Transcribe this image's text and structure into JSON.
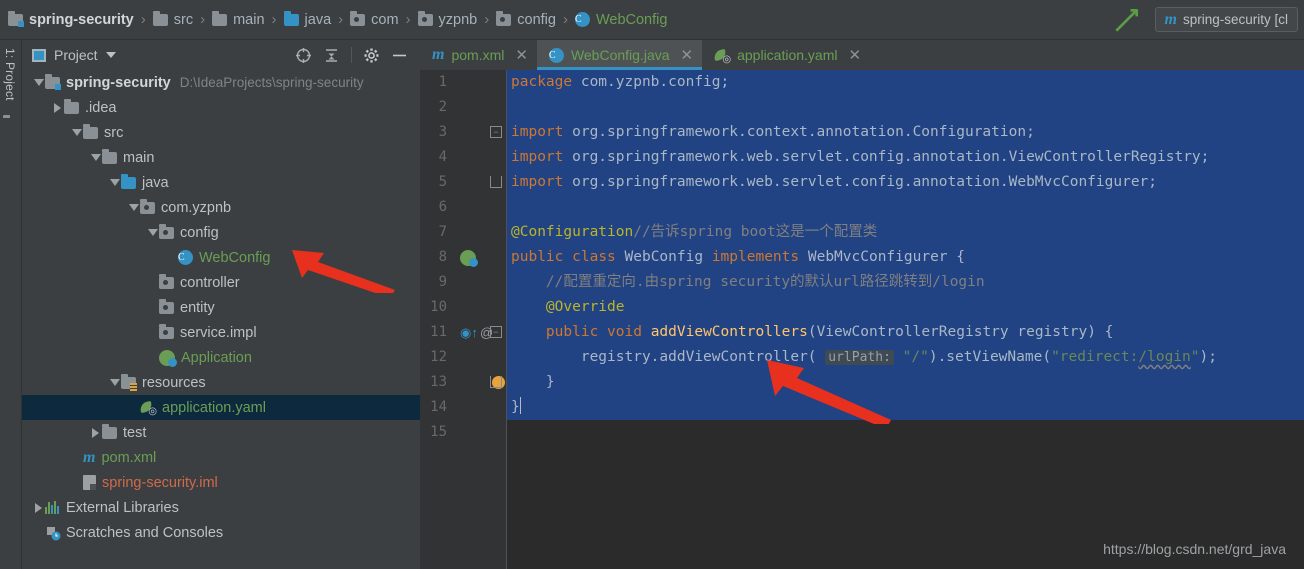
{
  "window": {
    "breadcrumb": [
      {
        "label": "spring-security",
        "icon": "module-folder-icon",
        "kind": "root"
      },
      {
        "label": "src",
        "icon": "folder-icon",
        "kind": "folder"
      },
      {
        "label": "main",
        "icon": "folder-icon",
        "kind": "folder"
      },
      {
        "label": "java",
        "icon": "source-folder-icon",
        "kind": "source"
      },
      {
        "label": "com",
        "icon": "package-icon",
        "kind": "package"
      },
      {
        "label": "yzpnb",
        "icon": "package-icon",
        "kind": "package"
      },
      {
        "label": "config",
        "icon": "package-icon",
        "kind": "package"
      },
      {
        "label": "WebConfig",
        "icon": "java-class-icon",
        "kind": "class"
      }
    ],
    "separator": "›",
    "run_arrow_icon": "run-arrow-icon",
    "run_config": {
      "icon": "maven-icon",
      "label": "spring-security [cl"
    }
  },
  "left_strip": {
    "tool_window_label": "1: Project",
    "folder_icon": "folder-icon"
  },
  "project_panel": {
    "title": "Project",
    "window_icon": "project-window-icon",
    "dropdown_icon": "chevron-down-icon",
    "actions": [
      {
        "name": "locate-icon",
        "glyph": "⊕"
      },
      {
        "name": "collapse-all-icon",
        "glyph": "⤓"
      },
      {
        "name": "settings-gear-icon",
        "glyph": "⚙"
      },
      {
        "name": "hide-panel-icon",
        "glyph": "—"
      }
    ],
    "tree": [
      {
        "indent": 0,
        "arrow": "down",
        "icon": "module-folder-icon",
        "label": "spring-security",
        "style": "bold",
        "sub": "D:\\IdeaProjects\\spring-security",
        "selected": false
      },
      {
        "indent": 1,
        "arrow": "right",
        "icon": "folder-icon",
        "label": ".idea",
        "style": "white",
        "sub": "",
        "selected": false
      },
      {
        "indent": 2,
        "arrow": "down",
        "icon": "folder-icon",
        "label": "src",
        "style": "white",
        "sub": "",
        "selected": false
      },
      {
        "indent": 3,
        "arrow": "down",
        "icon": "folder-icon",
        "label": "main",
        "style": "white",
        "sub": "",
        "selected": false
      },
      {
        "indent": 4,
        "arrow": "down",
        "icon": "source-folder-icon",
        "label": "java",
        "style": "white",
        "sub": "",
        "selected": false
      },
      {
        "indent": 5,
        "arrow": "down",
        "icon": "package-icon",
        "label": "com.yzpnb",
        "style": "white",
        "sub": "",
        "selected": false
      },
      {
        "indent": 6,
        "arrow": "down",
        "icon": "package-icon",
        "label": "config",
        "style": "white",
        "sub": "",
        "selected": false
      },
      {
        "indent": 7,
        "arrow": "none",
        "icon": "java-class-icon",
        "label": "WebConfig",
        "style": "green",
        "sub": "",
        "selected": false
      },
      {
        "indent": 6,
        "arrow": "none",
        "icon": "package-icon",
        "label": "controller",
        "style": "white",
        "sub": "",
        "selected": false
      },
      {
        "indent": 6,
        "arrow": "none",
        "icon": "package-icon",
        "label": "entity",
        "style": "white",
        "sub": "",
        "selected": false
      },
      {
        "indent": 6,
        "arrow": "none",
        "icon": "package-icon",
        "label": "service.impl",
        "style": "white",
        "sub": "",
        "selected": false
      },
      {
        "indent": 6,
        "arrow": "none",
        "icon": "spring-class-icon",
        "label": "Application",
        "style": "green",
        "sub": "",
        "selected": false
      },
      {
        "indent": 4,
        "arrow": "down",
        "icon": "resources-folder-icon",
        "label": "resources",
        "style": "white",
        "sub": "",
        "selected": false
      },
      {
        "indent": 5,
        "arrow": "none",
        "icon": "spring-yaml-icon",
        "label": "application.yaml",
        "style": "green",
        "sub": "",
        "selected": true
      },
      {
        "indent": 3,
        "arrow": "right",
        "icon": "folder-icon",
        "label": "test",
        "style": "white",
        "sub": "",
        "selected": false
      },
      {
        "indent": 2,
        "arrow": "none",
        "icon": "maven-icon",
        "label": "pom.xml",
        "style": "green",
        "sub": "",
        "selected": false
      },
      {
        "indent": 2,
        "arrow": "none",
        "icon": "iml-file-icon",
        "label": "spring-security.iml",
        "style": "red",
        "sub": "",
        "selected": false
      },
      {
        "indent": 0,
        "arrow": "right",
        "icon": "external-libraries-icon",
        "label": "External Libraries",
        "style": "white",
        "sub": "",
        "selected": false
      },
      {
        "indent": 0,
        "arrow": "none",
        "icon": "scratches-icon",
        "label": "Scratches and Consoles",
        "style": "white",
        "sub": "",
        "selected": false
      }
    ]
  },
  "editor": {
    "tabs": [
      {
        "label": "pom.xml",
        "icon": "maven-icon",
        "active": false,
        "close_glyph": "✕"
      },
      {
        "label": "WebConfig.java",
        "icon": "java-class-icon",
        "active": true,
        "close_glyph": "✕"
      },
      {
        "label": "application.yaml",
        "icon": "spring-yaml-icon",
        "active": false,
        "close_glyph": "✕"
      }
    ],
    "lines": [
      {
        "n": 1,
        "selected": true,
        "gutter": [],
        "fold": "",
        "tokens": [
          {
            "t": "package",
            "c": "kw"
          },
          {
            "t": " com.yzpnb.config;",
            "c": ""
          }
        ]
      },
      {
        "n": 2,
        "selected": true,
        "gutter": [],
        "fold": "",
        "tokens": []
      },
      {
        "n": 3,
        "selected": true,
        "gutter": [],
        "fold": "minus",
        "tokens": [
          {
            "t": "import",
            "c": "kw"
          },
          {
            "t": " org.springframework.context.annotation.Configuration;",
            "c": ""
          }
        ]
      },
      {
        "n": 4,
        "selected": true,
        "gutter": [],
        "fold": "",
        "tokens": [
          {
            "t": "import",
            "c": "kw"
          },
          {
            "t": " org.springframework.web.servlet.config.annotation.ViewControllerRegistry;",
            "c": ""
          }
        ]
      },
      {
        "n": 5,
        "selected": true,
        "gutter": [],
        "fold": "end",
        "tokens": [
          {
            "t": "import",
            "c": "kw"
          },
          {
            "t": " org.springframework.web.servlet.config.annotation.WebMvcConfigurer;",
            "c": ""
          }
        ]
      },
      {
        "n": 6,
        "selected": true,
        "gutter": [],
        "fold": "",
        "tokens": []
      },
      {
        "n": 7,
        "selected": true,
        "gutter": [],
        "fold": "",
        "tokens": [
          {
            "t": "@Configuration",
            "c": "ann"
          },
          {
            "t": "//告诉spring boot这是一个配置类",
            "c": "cmt"
          }
        ]
      },
      {
        "n": 8,
        "selected": true,
        "gutter": [
          "spring-bean-icon"
        ],
        "fold": "",
        "tokens": [
          {
            "t": "public",
            "c": "kw"
          },
          {
            "t": " ",
            "c": ""
          },
          {
            "t": "class",
            "c": "kw"
          },
          {
            "t": " WebConfig ",
            "c": ""
          },
          {
            "t": "implements",
            "c": "kw"
          },
          {
            "t": " WebMvcConfigurer {",
            "c": ""
          }
        ]
      },
      {
        "n": 9,
        "selected": true,
        "gutter": [],
        "fold": "",
        "tokens": [
          {
            "t": "    //配置重定向.由spring security的默认url路径跳转到/login",
            "c": "cmt"
          }
        ]
      },
      {
        "n": 10,
        "selected": true,
        "gutter": [],
        "fold": "",
        "tokens": [
          {
            "t": "    @Override",
            "c": "ann"
          }
        ]
      },
      {
        "n": 11,
        "selected": true,
        "gutter": [
          "override-method-icon",
          "annotation-icon"
        ],
        "fold": "minus",
        "tokens": [
          {
            "t": "    ",
            "c": ""
          },
          {
            "t": "public",
            "c": "kw"
          },
          {
            "t": " ",
            "c": ""
          },
          {
            "t": "void",
            "c": "kw"
          },
          {
            "t": " ",
            "c": ""
          },
          {
            "t": "addViewControllers",
            "c": "fn"
          },
          {
            "t": "(ViewControllerRegistry registry) {",
            "c": ""
          }
        ]
      },
      {
        "n": 12,
        "selected": true,
        "gutter": [],
        "fold": "",
        "tokens": [
          {
            "t": "        registry.addViewController( ",
            "c": ""
          },
          {
            "t": "urlPath:",
            "c": "hint"
          },
          {
            "t": " ",
            "c": ""
          },
          {
            "t": "\"/\"",
            "c": "str"
          },
          {
            "t": ").setViewName(",
            "c": ""
          },
          {
            "t": "\"redirect:",
            "c": "str"
          },
          {
            "t": "/login",
            "c": "str wavy"
          },
          {
            "t": "\"",
            "c": "str"
          },
          {
            "t": ");",
            "c": ""
          }
        ]
      },
      {
        "n": 13,
        "selected": true,
        "gutter": [
          "intention-bulb-icon"
        ],
        "fold": "end",
        "tokens": [
          {
            "t": "    }",
            "c": ""
          }
        ]
      },
      {
        "n": 14,
        "selected": true,
        "gutter": [],
        "fold": "",
        "tokens": [
          {
            "t": "}",
            "c": ""
          }
        ],
        "caret": true
      },
      {
        "n": 15,
        "selected": false,
        "gutter": [],
        "fold": "",
        "tokens": []
      }
    ],
    "watermark": "https://blog.csdn.net/grd_java"
  },
  "annotations": [
    {
      "name": "arrow-pointing-to-webconfig",
      "color": "#E8301E"
    },
    {
      "name": "arrow-pointing-to-addviewcontroller",
      "color": "#E8301E"
    }
  ],
  "colors": {
    "accent_blue": "#3592C4",
    "selection_blue": "#214283",
    "tree_selection": "#0D293E",
    "green_text": "#6A9E55",
    "keyword_orange": "#CC7832",
    "annotation_yellow": "#BBB529",
    "annotation_red": "#E8301E"
  }
}
